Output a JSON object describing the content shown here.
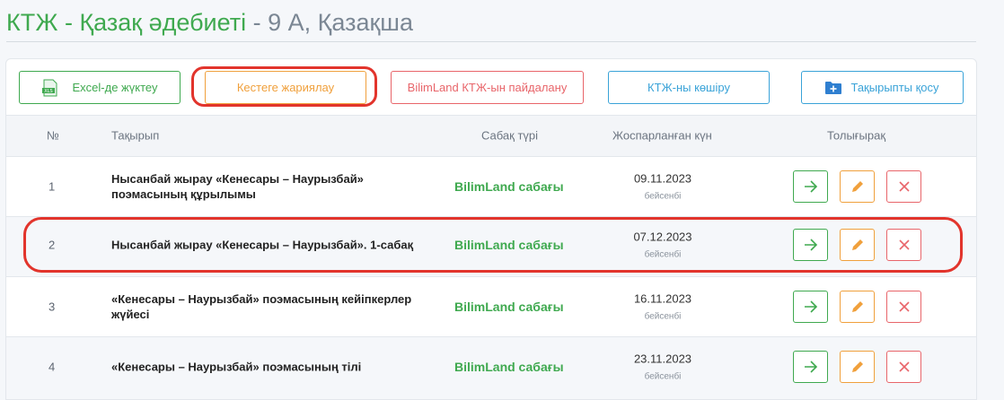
{
  "page": {
    "title_green": "КТЖ - Қазақ әдебиеті",
    "title_grey": " - 9 А, Қазақша"
  },
  "toolbar": {
    "excel_label": "Excel-де жүктеу",
    "publish_label": "Кестеге жариялау",
    "bilimland_label": "BilimLand КТЖ-ын пайдалану",
    "copy_label": "КТЖ-ны көшіру",
    "add_topic_label": "Тақырыпты қосу",
    "excel_icon": "xls-file-icon",
    "add_topic_icon": "folder-plus-icon"
  },
  "table": {
    "headers": {
      "num": "№",
      "topic": "Тақырып",
      "type": "Сабақ түрі",
      "date": "Жоспарланған күн",
      "more": "Толығырақ"
    },
    "rows": [
      {
        "num": "1",
        "topic": "Нысанбай жырау «Кенесары – Наурызбай» поэмасының құрылымы",
        "type": "BilimLand сабағы",
        "date": "09.11.2023",
        "day": "бейсенбі"
      },
      {
        "num": "2",
        "topic": "Нысанбай жырау «Кенесары – Наурызбай». 1-сабақ",
        "type": "BilimLand сабағы",
        "date": "07.12.2023",
        "day": "бейсенбі"
      },
      {
        "num": "3",
        "topic": "«Кенесары – Наурызбай» поэмасының кейіпкерлер жүйесі",
        "type": "BilimLand сабағы",
        "date": "16.11.2023",
        "day": "бейсенбі"
      },
      {
        "num": "4",
        "topic": "«Кенесары – Наурызбай» поэмасының тілі",
        "type": "BilimLand сабағы",
        "date": "23.11.2023",
        "day": "бейсенбі"
      }
    ],
    "row_actions": [
      "arrow-right-icon",
      "pencil-icon",
      "close-icon"
    ]
  },
  "colors": {
    "green": "#3fa94f",
    "orange": "#f0a03c",
    "red": "#e8656a",
    "blue": "#3aa3d8",
    "annotation_red": "#e2342c"
  }
}
